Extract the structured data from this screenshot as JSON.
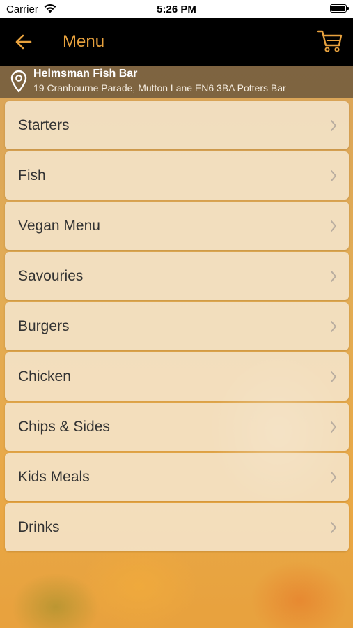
{
  "status_bar": {
    "carrier": "Carrier",
    "time": "5:26 PM",
    "icons": [
      "wifi-icon",
      "battery-icon"
    ]
  },
  "nav": {
    "title": "Menu",
    "back_icon": "arrow-left-icon",
    "cart_icon": "cart-icon",
    "accent_color": "#e8a23e"
  },
  "location": {
    "icon": "location-pin-icon",
    "name": "Helmsman Fish Bar",
    "address": "19 Cranbourne Parade, Mutton Lane EN6 3BA Potters Bar"
  },
  "menu": {
    "chevron_icon": "chevron-right-icon",
    "items": [
      {
        "label": "Starters"
      },
      {
        "label": "Fish"
      },
      {
        "label": "Vegan Menu"
      },
      {
        "label": "Savouries"
      },
      {
        "label": "Burgers"
      },
      {
        "label": "Chicken"
      },
      {
        "label": "Chips & Sides"
      },
      {
        "label": "Kids Meals"
      },
      {
        "label": "Drinks"
      }
    ]
  }
}
